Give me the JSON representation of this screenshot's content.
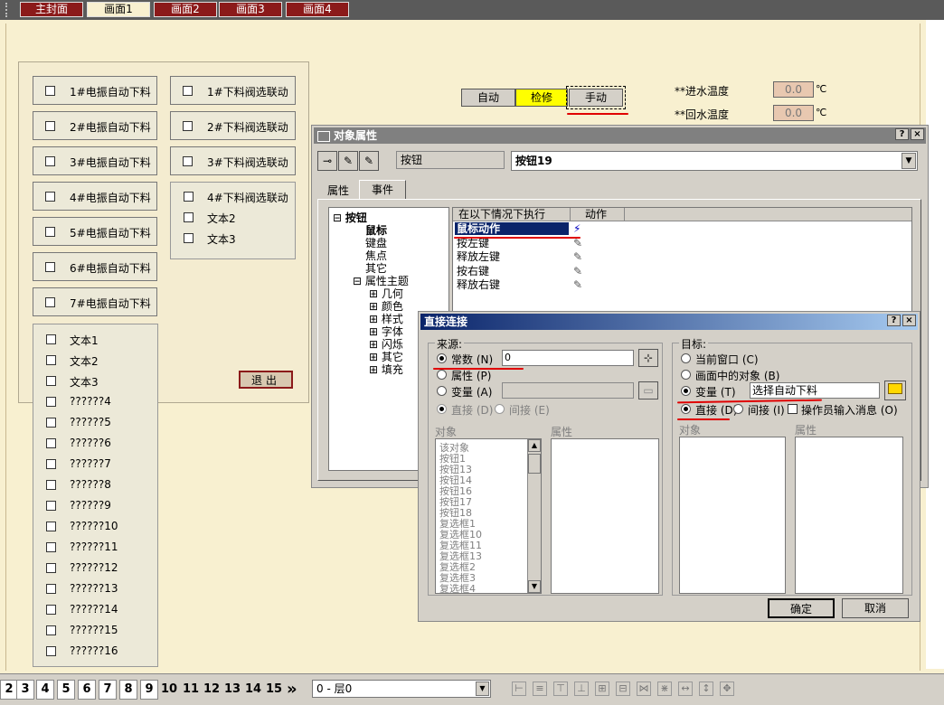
{
  "tabs": [
    "主封面",
    "画面1",
    "画面2",
    "画面3",
    "画面4"
  ],
  "left_buttons": [
    "1#电振自动下料",
    "2#电振自动下料",
    "3#电振自动下料",
    "4#电振自动下料",
    "5#电振自动下料",
    "6#电振自动下料",
    "7#电振自动下料"
  ],
  "mid_buttons": [
    "1#下料阀选联动",
    "2#下料阀选联动",
    "3#下料阀选联动"
  ],
  "mid_panel": [
    "4#下料阀选联动",
    "文本2",
    "文本3"
  ],
  "list_items": [
    "文本1",
    "文本2",
    "文本3",
    "??????4",
    "??????5",
    "??????6",
    "??????7",
    "??????8",
    "??????9",
    "??????10",
    "??????11",
    "??????12",
    "??????13",
    "??????14",
    "??????15",
    "??????16"
  ],
  "exit_label": "退出",
  "mode": {
    "auto": "自动",
    "maint": "检修",
    "manual": "手动"
  },
  "temps": {
    "in_label": "**进水温度",
    "out_label": "**回水温度",
    "in_value": "0.0",
    "out_value": "0.0",
    "unit": "℃"
  },
  "obj_dialog": {
    "title": "对象属性",
    "help": "?",
    "close": "×",
    "type_label": "按钮",
    "name_value": "按钮19",
    "tabs": [
      "属性",
      "事件"
    ],
    "tree_root": "按钮",
    "tree_mouse": "鼠标",
    "tree_items": [
      "键盘",
      "焦点",
      "其它"
    ],
    "tree_theme": "属性主题",
    "tree_theme_items": [
      "几何",
      "颜色",
      "样式",
      "字体",
      "闪烁",
      "其它",
      "填充"
    ],
    "col_condition": "在以下情况下执行",
    "col_action": "动作",
    "events": [
      "鼠标动作",
      "按左键",
      "释放左键",
      "按右键",
      "释放右键"
    ]
  },
  "conn_dialog": {
    "title": "直接连接",
    "help": "?",
    "close": "×",
    "source_label": "来源:",
    "const_label": "常数 (N)",
    "const_value": "0",
    "prop_label": "属性 (P)",
    "var_label": "变量 (A)",
    "direct_label": "直接 (D)",
    "indirect_label": "间接 (E)",
    "obj_header": "对象",
    "prop_header": "属性",
    "objects": [
      "该对象",
      "按钮1",
      "按钮13",
      "按钮14",
      "按钮16",
      "按钮17",
      "按钮18",
      "复选框1",
      "复选框10",
      "复选框11",
      "复选框13",
      "复选框2",
      "复选框3",
      "复选框4"
    ],
    "target_label": "目标:",
    "cur_window": "当前窗口 (C)",
    "obj_in_screen": "画面中的对象 (B)",
    "target_var": "变量 (T)",
    "target_var_value": "选择自动下料",
    "t_direct": "直接 (D)",
    "t_indirect": "间接 (I)",
    "operator_msg": "操作员输入消息 (O)",
    "t_obj_header": "对象",
    "t_prop_header": "属性",
    "ok": "确定",
    "cancel": "取消"
  },
  "bottom": {
    "pages": [
      "2",
      "3",
      "4",
      "5",
      "6",
      "7",
      "8",
      "9",
      "10",
      "11",
      "12",
      "13",
      "14",
      "15"
    ],
    "next": "»",
    "layer": "0 - 层0"
  }
}
